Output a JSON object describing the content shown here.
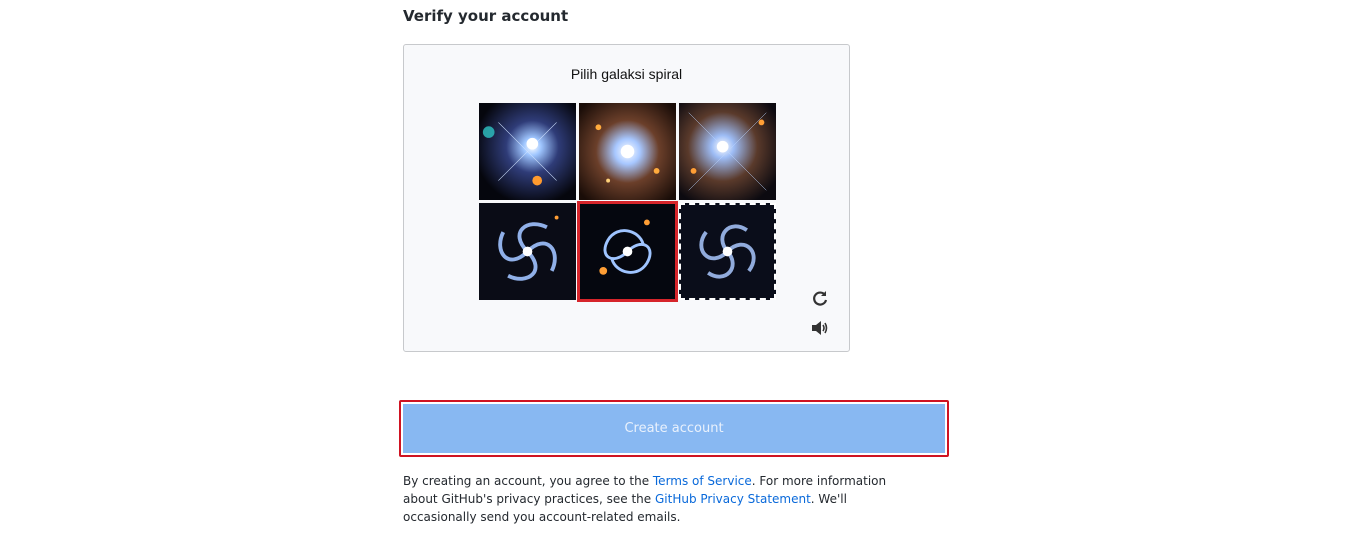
{
  "page": {
    "verify_title": "Verify your account"
  },
  "captcha": {
    "prompt": "Pilih galaksi spiral",
    "tiles": [
      {
        "name": "captcha-tile-1",
        "state": "default"
      },
      {
        "name": "captcha-tile-2",
        "state": "default"
      },
      {
        "name": "captcha-tile-3",
        "state": "default"
      },
      {
        "name": "captcha-tile-4",
        "state": "default"
      },
      {
        "name": "captcha-tile-5",
        "state": "selected"
      },
      {
        "name": "captcha-tile-6",
        "state": "hovered"
      }
    ],
    "icons": {
      "refresh": "refresh-icon",
      "audio": "audio-icon"
    }
  },
  "form": {
    "create_label": "Create account"
  },
  "legal": {
    "part1": "By creating an account, you agree to the ",
    "terms_link": "Terms of Service",
    "part2": ". For more information about GitHub's privacy practices, see the ",
    "privacy_link": "GitHub Privacy Statement",
    "part3": ". We'll occasionally send you account-related emails."
  },
  "colors": {
    "accent": "#0969da",
    "button_disabled": "#88b8f2",
    "highlight": "#d6252b"
  }
}
